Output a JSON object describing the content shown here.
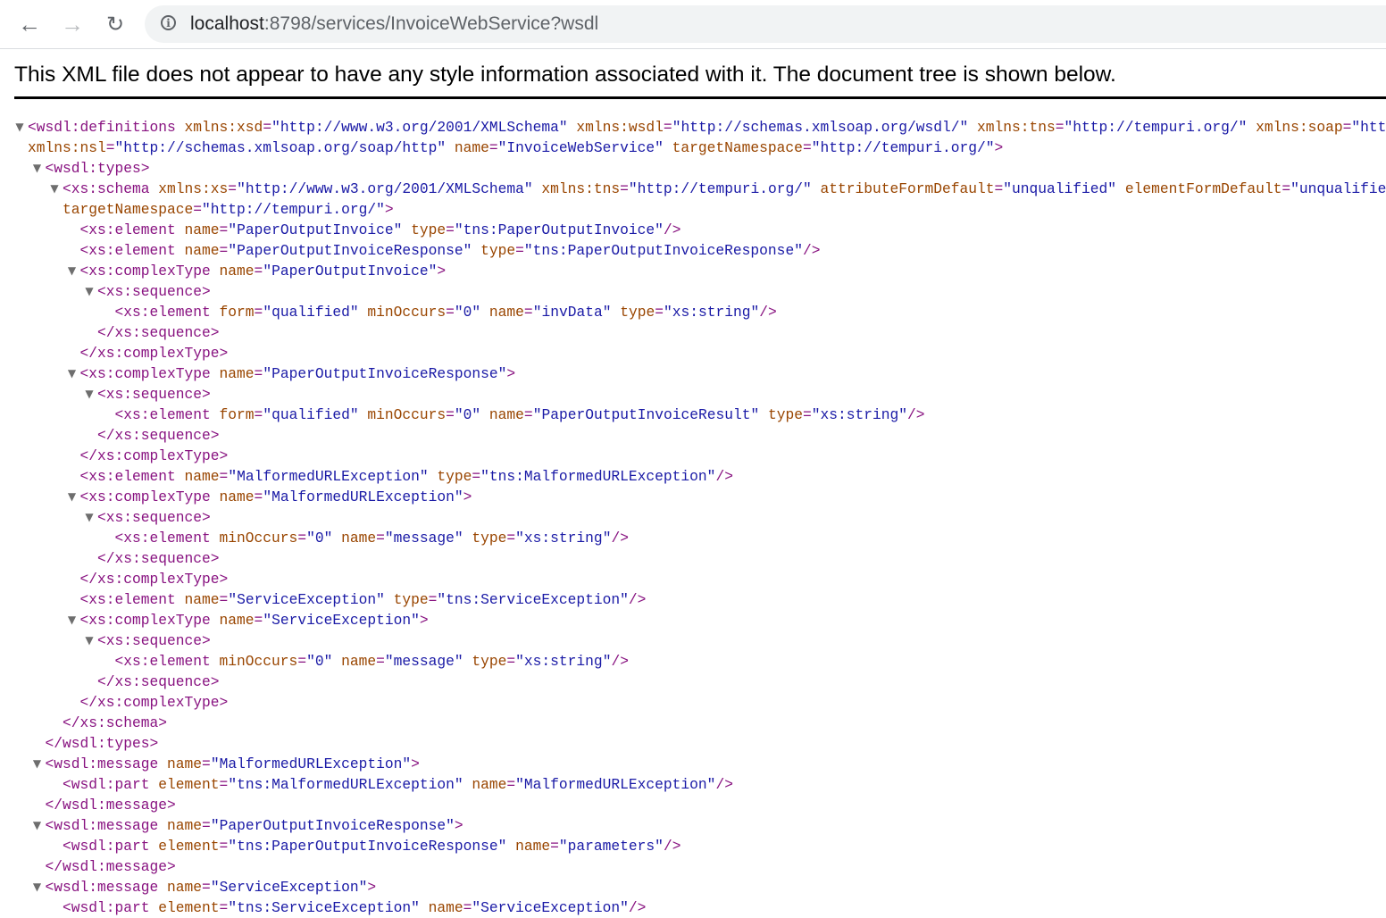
{
  "browser": {
    "back_icon": "arrow-left-icon",
    "forward_icon": "arrow-right-icon",
    "reload_icon": "reload-icon",
    "info_icon": "info-icon",
    "url_host": "localhost",
    "url_rest": ":8798/services/InvoiceWebService?wsdl"
  },
  "notice": "This XML file does not appear to have any style information associated with it. The document tree is shown below.",
  "colors": {
    "tag": "#881280",
    "attr_name": "#994500",
    "attr_value": "#1a1aa6"
  },
  "lines": [
    {
      "level": 0,
      "toggle": true,
      "tag": "wsdl:definitions",
      "attrs": [
        [
          "xmlns:xsd",
          "http://www.w3.org/2001/XMLSchema"
        ],
        [
          "xmlns:wsdl",
          "http://schemas.xmlsoap.org/wsdl/"
        ],
        [
          "xmlns:tns",
          "http://tempuri.org/"
        ],
        [
          "xmlns:soap",
          "htt",
          true
        ]
      ],
      "end": ""
    },
    {
      "level": 0,
      "cont": true,
      "attrs": [
        [
          "xmlns:nsl",
          "http://schemas.xmlsoap.org/soap/http"
        ],
        [
          "name",
          "InvoiceWebService"
        ],
        [
          "targetNamespace",
          "http://tempuri.org/"
        ]
      ],
      "end": ">"
    },
    {
      "level": 1,
      "toggle": true,
      "tag": "wsdl:types",
      "attrs": [],
      "end": ">"
    },
    {
      "level": 2,
      "toggle": true,
      "tag": "xs:schema",
      "attrs": [
        [
          "xmlns:xs",
          "http://www.w3.org/2001/XMLSchema"
        ],
        [
          "xmlns:tns",
          "http://tempuri.org/"
        ],
        [
          "attributeFormDefault",
          "unqualified"
        ],
        [
          "elementFormDefault",
          "unqualifie",
          true
        ]
      ],
      "end": ""
    },
    {
      "level": 2,
      "cont": true,
      "attrs": [
        [
          "targetNamespace",
          "http://tempuri.org/"
        ]
      ],
      "end": ">",
      "nospace": true
    },
    {
      "level": 3,
      "tag": "xs:element",
      "attrs": [
        [
          "name",
          "PaperOutputInvoice"
        ],
        [
          "type",
          "tns:PaperOutputInvoice"
        ]
      ],
      "end": "/>"
    },
    {
      "level": 3,
      "tag": "xs:element",
      "attrs": [
        [
          "name",
          "PaperOutputInvoiceResponse"
        ],
        [
          "type",
          "tns:PaperOutputInvoiceResponse"
        ]
      ],
      "end": "/>"
    },
    {
      "level": 3,
      "toggle": true,
      "tag": "xs:complexType",
      "attrs": [
        [
          "name",
          "PaperOutputInvoice"
        ]
      ],
      "end": ">"
    },
    {
      "level": 4,
      "toggle": true,
      "tag": "xs:sequence",
      "attrs": [],
      "end": ">"
    },
    {
      "level": 5,
      "tag": "xs:element",
      "attrs": [
        [
          "form",
          "qualified"
        ],
        [
          "minOccurs",
          "0"
        ],
        [
          "name",
          "invData"
        ],
        [
          "type",
          "xs:string"
        ]
      ],
      "end": "/>"
    },
    {
      "level": 4,
      "close": true,
      "tag": "xs:sequence"
    },
    {
      "level": 3,
      "close": true,
      "tag": "xs:complexType"
    },
    {
      "level": 3,
      "toggle": true,
      "tag": "xs:complexType",
      "attrs": [
        [
          "name",
          "PaperOutputInvoiceResponse"
        ]
      ],
      "end": ">"
    },
    {
      "level": 4,
      "toggle": true,
      "tag": "xs:sequence",
      "attrs": [],
      "end": ">"
    },
    {
      "level": 5,
      "tag": "xs:element",
      "attrs": [
        [
          "form",
          "qualified"
        ],
        [
          "minOccurs",
          "0"
        ],
        [
          "name",
          "PaperOutputInvoiceResult"
        ],
        [
          "type",
          "xs:string"
        ]
      ],
      "end": "/>"
    },
    {
      "level": 4,
      "close": true,
      "tag": "xs:sequence"
    },
    {
      "level": 3,
      "close": true,
      "tag": "xs:complexType"
    },
    {
      "level": 3,
      "tag": "xs:element",
      "attrs": [
        [
          "name",
          "MalformedURLException"
        ],
        [
          "type",
          "tns:MalformedURLException"
        ]
      ],
      "end": "/>"
    },
    {
      "level": 3,
      "toggle": true,
      "tag": "xs:complexType",
      "attrs": [
        [
          "name",
          "MalformedURLException"
        ]
      ],
      "end": ">"
    },
    {
      "level": 4,
      "toggle": true,
      "tag": "xs:sequence",
      "attrs": [],
      "end": ">"
    },
    {
      "level": 5,
      "tag": "xs:element",
      "attrs": [
        [
          "minOccurs",
          "0"
        ],
        [
          "name",
          "message"
        ],
        [
          "type",
          "xs:string"
        ]
      ],
      "end": "/>"
    },
    {
      "level": 4,
      "close": true,
      "tag": "xs:sequence"
    },
    {
      "level": 3,
      "close": true,
      "tag": "xs:complexType"
    },
    {
      "level": 3,
      "tag": "xs:element",
      "attrs": [
        [
          "name",
          "ServiceException"
        ],
        [
          "type",
          "tns:ServiceException"
        ]
      ],
      "end": "/>"
    },
    {
      "level": 3,
      "toggle": true,
      "tag": "xs:complexType",
      "attrs": [
        [
          "name",
          "ServiceException"
        ]
      ],
      "end": ">"
    },
    {
      "level": 4,
      "toggle": true,
      "tag": "xs:sequence",
      "attrs": [],
      "end": ">"
    },
    {
      "level": 5,
      "tag": "xs:element",
      "attrs": [
        [
          "minOccurs",
          "0"
        ],
        [
          "name",
          "message"
        ],
        [
          "type",
          "xs:string"
        ]
      ],
      "end": "/>"
    },
    {
      "level": 4,
      "close": true,
      "tag": "xs:sequence"
    },
    {
      "level": 3,
      "close": true,
      "tag": "xs:complexType"
    },
    {
      "level": 2,
      "close": true,
      "tag": "xs:schema"
    },
    {
      "level": 1,
      "close": true,
      "tag": "wsdl:types"
    },
    {
      "level": 1,
      "toggle": true,
      "tag": "wsdl:message",
      "attrs": [
        [
          "name",
          "MalformedURLException"
        ]
      ],
      "end": ">"
    },
    {
      "level": 2,
      "tag": "wsdl:part",
      "attrs": [
        [
          "element",
          "tns:MalformedURLException"
        ],
        [
          "name",
          "MalformedURLException"
        ]
      ],
      "end": "/>"
    },
    {
      "level": 1,
      "close": true,
      "tag": "wsdl:message"
    },
    {
      "level": 1,
      "toggle": true,
      "tag": "wsdl:message",
      "attrs": [
        [
          "name",
          "PaperOutputInvoiceResponse"
        ]
      ],
      "end": ">"
    },
    {
      "level": 2,
      "tag": "wsdl:part",
      "attrs": [
        [
          "element",
          "tns:PaperOutputInvoiceResponse"
        ],
        [
          "name",
          "parameters"
        ]
      ],
      "end": "/>"
    },
    {
      "level": 1,
      "close": true,
      "tag": "wsdl:message"
    },
    {
      "level": 1,
      "toggle": true,
      "tag": "wsdl:message",
      "attrs": [
        [
          "name",
          "ServiceException"
        ]
      ],
      "end": ">"
    },
    {
      "level": 2,
      "tag": "wsdl:part",
      "attrs": [
        [
          "element",
          "tns:ServiceException"
        ],
        [
          "name",
          "ServiceException"
        ]
      ],
      "end": "/>"
    }
  ]
}
